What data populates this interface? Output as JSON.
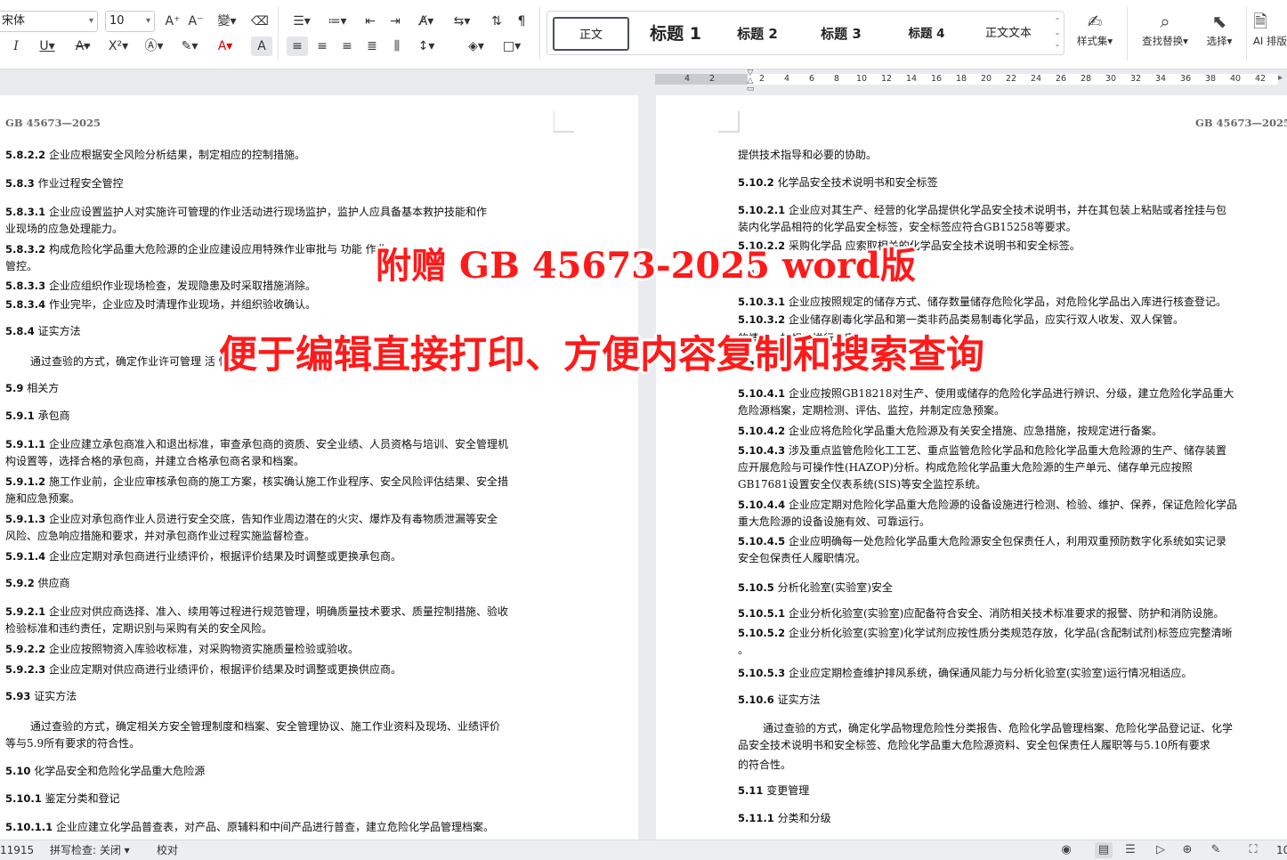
{
  "ribbon": {
    "font_name": "宋体",
    "font_size": "10",
    "styles": [
      "正文",
      "标题 1",
      "标题 2",
      "标题 3",
      "标题 4",
      "正文文本"
    ],
    "style_set_label": "样式集",
    "find_replace_label": "查找替换",
    "select_label": "选择",
    "ai_label": "AI 排版"
  },
  "ruler": {
    "left_ticks": [
      "4",
      "2"
    ],
    "right_ticks": [
      "2",
      "4",
      "6",
      "8",
      "10",
      "12",
      "14",
      "16",
      "18",
      "20",
      "22",
      "24",
      "26",
      "28",
      "30",
      "32",
      "34",
      "36",
      "38",
      "40",
      "42"
    ]
  },
  "header_text": "GB  45673—2025",
  "left_page": [
    {
      "num": "5.8.2.2",
      "text": "企业应根据安全风险分析结果，制定相应的控制措施。"
    },
    {
      "num": "5.8.3",
      "text": "作业过程安全管控"
    },
    {
      "num": "5.8.3.1",
      "text": "企业应设置监护人对实施许可管理的作业活动进行现场监护，监护人应具备基本救护技能和作"
    },
    {
      "num": "",
      "text": "业现场的应急处理能力。"
    },
    {
      "num": "5.8.3.2",
      "text": "构成危险化学品重大危险源的企业应建设应用特殊作业审批与                          功能             作业"
    },
    {
      "num": "",
      "text": "管控。"
    },
    {
      "num": "5.8.3.3",
      "text": "企业应组织作业现场检查，发现隐患及时采取措施消除。"
    },
    {
      "num": "5.8.3.4",
      "text": "作业完毕，企业应及时清理作业现场，并组织验收确认。"
    },
    {
      "num": "5.8.4",
      "text": "证实方法"
    },
    {
      "num": "",
      "text": "通过查验的方式，确定作业许可管理                   活                                                       性"
    },
    {
      "num": "5.9",
      "text": "相关方"
    },
    {
      "num": "5.9.1",
      "text": "承包商"
    },
    {
      "num": "5.9.1.1",
      "text": "企业应建立承包商准入和退出标准，审查承包商的资质、安全业绩、人员资格与培训、安全管理机"
    },
    {
      "num": "",
      "text": "构设置等，选择合格的承包商，并建立合格承包商名录和档案。"
    },
    {
      "num": "5.9.1.2",
      "text": "施工作业前，企业应审核承包商的施工方案，核实确认施工作业程序、安全风险评估结果、安全措"
    },
    {
      "num": "",
      "text": "施和应急预案。"
    },
    {
      "num": "5.9.1.3",
      "text": "企业应对承包商作业人员进行安全交底，告知作业周边潜在的火灾、爆炸及有毒物质泄漏等安全"
    },
    {
      "num": "",
      "text": "风险、应急响应措施和要求，并对承包商作业过程实施监督检查。"
    },
    {
      "num": "5.9.1.4",
      "text": "企业应定期对承包商进行业绩评价，根据评价结果及时调整或更换承包商。"
    },
    {
      "num": "5.9.2",
      "text": "供应商"
    },
    {
      "num": "5.9.2.1",
      "text": "企业应对供应商选择、准入、续用等过程进行规范管理，明确质量技术要求、质量控制措施、验收"
    },
    {
      "num": "",
      "text": "检验标准和违约责任，定期识别与采购有关的安全风险。"
    },
    {
      "num": "5.9.2.2",
      "text": "企业应按照物资入库验收标准，对采购物资实施质量检验或验收。"
    },
    {
      "num": "5.9.2.3",
      "text": "企业应定期对供应商进行业绩评价，根据评价结果及时调整或更换供应商。"
    },
    {
      "num": "5.93",
      "text": "证实方法"
    },
    {
      "num": "",
      "text": "通过查验的方式，确定相关方安全管理制度和档案、安全管理协议、施工作业资料及现场、业绩评价"
    },
    {
      "num": "",
      "text": "等与5.9所有要求的符合性。"
    },
    {
      "num": "5.10",
      "text": "化学品安全和危险化学品重大危险源"
    },
    {
      "num": "5.10.1",
      "text": "鉴定分类和登记"
    },
    {
      "num": "5.10.1.1",
      "text": "企业应建立化学品普查表，对产品、原辅料和中间产品进行普查，建立危险化学品管理档案。"
    }
  ],
  "right_page": [
    {
      "num": "",
      "text": "提供技术指导和必要的协助。"
    },
    {
      "num": "5.10.2",
      "text": "化学品安全技术说明书和安全标签"
    },
    {
      "num": "5.10.2.1",
      "text": "企业应对其生产、经营的化学品提供化学品安全技术说明书，并在其包装上粘贴或者拴挂与包"
    },
    {
      "num": "",
      "text": "装内化学品相符的化学品安全标签，安全标签应符合GB15258等要求。"
    },
    {
      "num": "5.10.2.2",
      "text": "采购化学品              应索取相关的化学品安全技术说明书和安全标签。"
    },
    {
      "num": "5.10.",
      "text": ""
    },
    {
      "num": "5.10.3.1",
      "text": "企业应按照规定的储存方式、储存数量储存危险化学品，对危险化学品出入库进行核查登记。"
    },
    {
      "num": "5.10.3.2",
      "text": "企业储存剧毒化学品和第一类非药品类易制毒化学品，应实行双人收发、双人保管。"
    },
    {
      "num": "",
      "text": "                                                                                             的情况，按规定进行备案。"
    },
    {
      "num": "5.10",
      "text": ""
    },
    {
      "num": "5.10.4.1",
      "text": "企业应按照GB18218对生产、使用或储存的危险化学品进行辨识、分级，建立危险化学品重大"
    },
    {
      "num": "",
      "text": "危险源档案，定期检测、评估、监控，并制定应急预案。"
    },
    {
      "num": "5.10.4.2",
      "text": "企业应将危险化学品重大危险源及有关安全措施、应急措施，按规定进行备案。"
    },
    {
      "num": "5.10.4.3",
      "text": "涉及重点监管危险化工工艺、重点监管危险化学品和危险化学品重大危险源的生产、储存装置"
    },
    {
      "num": "",
      "text": "应开展危险与可操作性(HAZOP)分析。构成危险化学品重大危险源的生产单元、储存单元应按照"
    },
    {
      "num": "",
      "text": "GB17681设置安全仪表系统(SIS)等安全监控系统。"
    },
    {
      "num": "5.10.4.4",
      "text": "企业应定期对危险化学品重大危险源的设备设施进行检测、检验、维护、保养，保证危险化学品"
    },
    {
      "num": "",
      "text": "重大危险源的设备设施有效、可靠运行。"
    },
    {
      "num": "5.10.4.5",
      "text": "企业应明确每一处危险化学品重大危险源安全包保责任人，利用双重预防数字化系统如实记录"
    },
    {
      "num": "",
      "text": "安全包保责任人履职情况。"
    },
    {
      "num": "5.10.5",
      "text": "分析化验室(实验室)安全"
    },
    {
      "num": "5.10.5.1",
      "text": "企业分析化验室(实验室)应配备符合安全、消防相关技术标准要求的报警、防护和消防设施。"
    },
    {
      "num": "5.10.5.2",
      "text": "企业分析化验室(实验室)化学试剂应按性质分类规范存放，化学品(含配制试剂)标签应完整清晰"
    },
    {
      "num": "",
      "text": "。"
    },
    {
      "num": "5.10.5.3",
      "text": "企业应定期检查维护排风系统，确保通风能力与分析化验室(实验室)运行情况相适应。"
    },
    {
      "num": "5.10.6",
      "text": "证实方法"
    },
    {
      "num": "",
      "text": "通过查验的方式，确定化学品物理危险性分类报告、危险化学品管理档案、危险化学品登记证、化学"
    },
    {
      "num": "",
      "text": "品安全技术说明书和安全标签、危险化学品重大危险源资料、安全包保责任人履职等与5.10所有要求"
    },
    {
      "num": "",
      "text": "的符合性。"
    },
    {
      "num": "5.11",
      "text": "变更管理"
    },
    {
      "num": "5.11.1",
      "text": "分类和分级"
    }
  ],
  "overlay": {
    "line1": "附赠 GB 45673-2025 word版",
    "line2": "便于编辑直接打印、方便内容复制和搜索查询",
    "color": "#ff1a1a"
  },
  "status": {
    "word_count": "11915",
    "spell_check": "拼写检查: 关闭",
    "proofread": "校对",
    "zoom_fragment": "10"
  }
}
